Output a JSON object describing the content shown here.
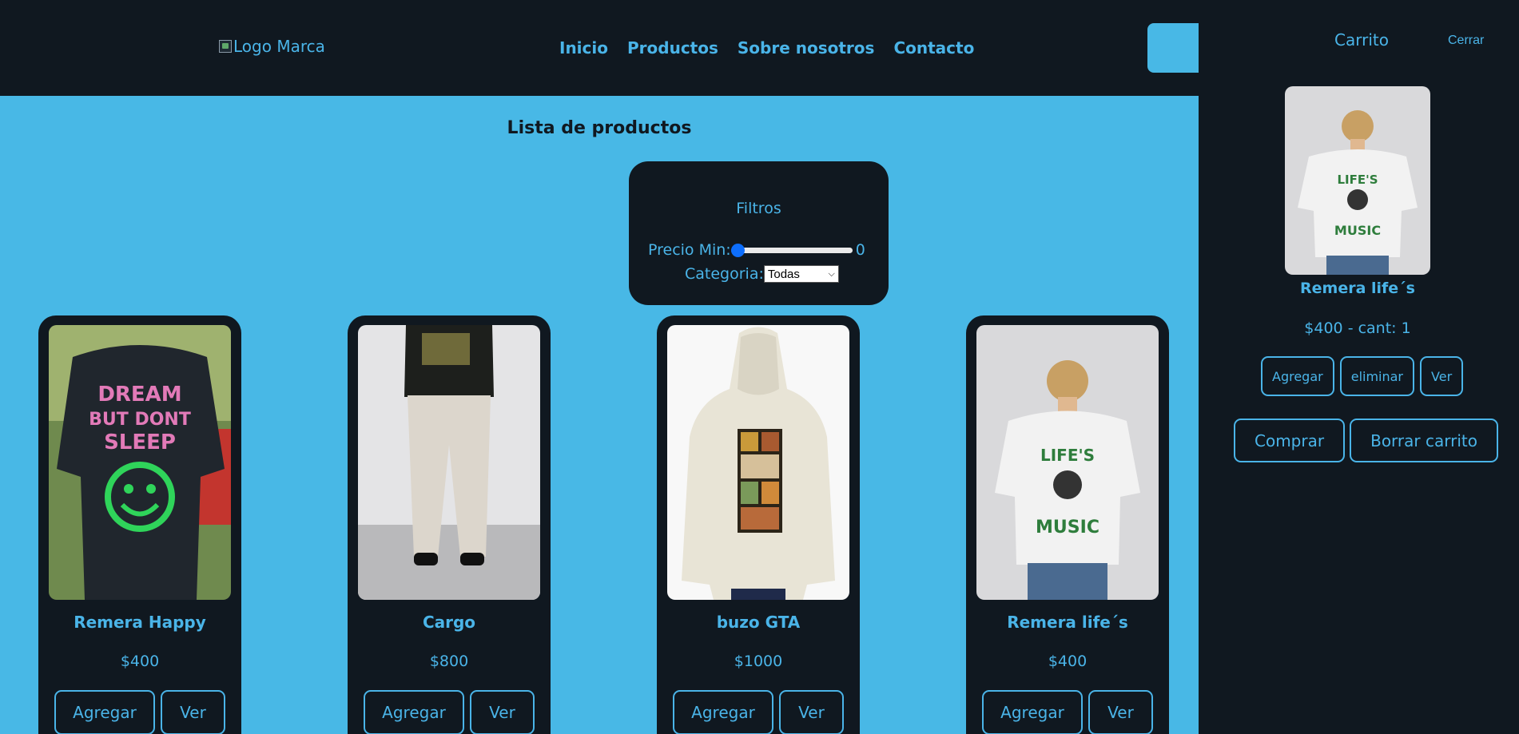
{
  "header": {
    "logo_alt": "Logo Marca",
    "nav": [
      "Inicio",
      "Productos",
      "Sobre nosotros",
      "Contacto"
    ]
  },
  "main": {
    "title": "Lista de productos",
    "filters": {
      "title": "Filtros",
      "price_label": "Precio Min:",
      "price_value": "0",
      "price_slider_fraction": 0,
      "category_label": "Categoria:",
      "category_selected": "Todas"
    },
    "products": [
      {
        "name": "Remera Happy",
        "price": "$400",
        "add_label": "Agregar",
        "view_label": "Ver"
      },
      {
        "name": "Cargo",
        "price": "$800",
        "add_label": "Agregar",
        "view_label": "Ver"
      },
      {
        "name": "buzo GTA",
        "price": "$1000",
        "add_label": "Agregar",
        "view_label": "Ver"
      },
      {
        "name": "Remera life´s",
        "price": "$400",
        "add_label": "Agregar",
        "view_label": "Ver"
      }
    ]
  },
  "cart": {
    "title": "Carrito",
    "close_label": "Cerrar",
    "item": {
      "name": "Remera life´s",
      "price_qty": "$400 - cant: 1",
      "add_label": "Agregar",
      "remove_label": "eliminar",
      "view_label": "Ver"
    },
    "buy_label": "Comprar",
    "clear_label": "Borrar carrito"
  },
  "colors": {
    "accent": "#4ab4e8",
    "background": "#48b8e6",
    "dark": "#101820",
    "slider": "#0d6efd"
  }
}
